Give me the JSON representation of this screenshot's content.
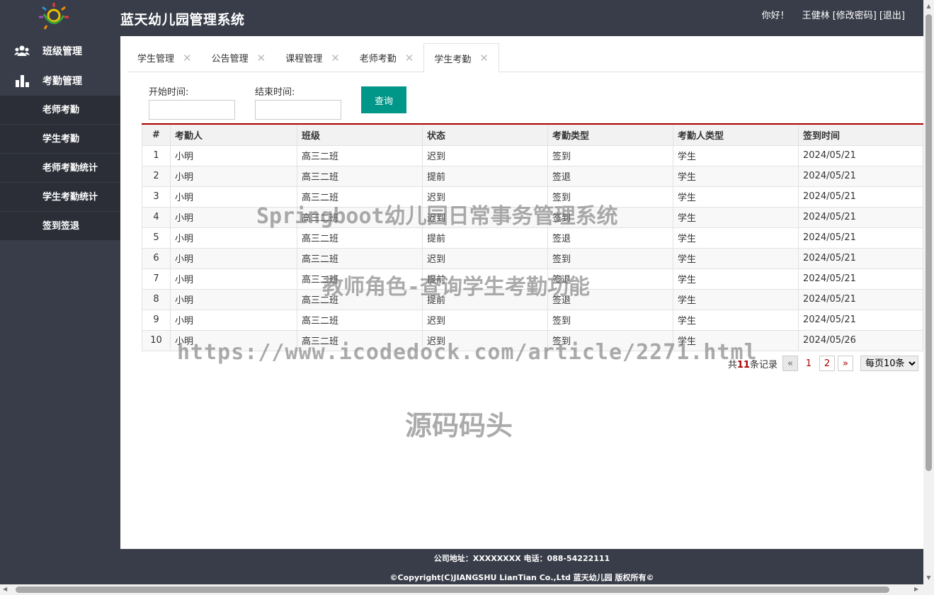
{
  "header": {
    "title": "蓝天幼儿园管理系统",
    "greeting": "你好！",
    "username": "王健林",
    "change_password": "[修改密码]",
    "logout": "[退出]"
  },
  "sidebar": {
    "groups": [
      {
        "label": "班级管理",
        "icon": "users-icon"
      },
      {
        "label": "考勤管理",
        "icon": "bar-chart-icon"
      }
    ],
    "sub_items": [
      "老师考勤",
      "学生考勤",
      "老师考勤统计",
      "学生考勤统计",
      "签到签退"
    ]
  },
  "tabs": [
    {
      "label": "学生管理",
      "active": false
    },
    {
      "label": "公告管理",
      "active": false
    },
    {
      "label": "课程管理",
      "active": false
    },
    {
      "label": "老师考勤",
      "active": false
    },
    {
      "label": "学生考勤",
      "active": true
    }
  ],
  "filters": {
    "start_label": "开始时间:",
    "start_value": "",
    "end_label": "结束时间:",
    "end_value": "",
    "query_button": "查询"
  },
  "table": {
    "columns": [
      "#",
      "考勤人",
      "班级",
      "状态",
      "考勤类型",
      "考勤人类型",
      "签到时间"
    ],
    "rows": [
      [
        "1",
        "小明",
        "高三二班",
        "迟到",
        "签到",
        "学生",
        "2024/05/21"
      ],
      [
        "2",
        "小明",
        "高三二班",
        "提前",
        "签退",
        "学生",
        "2024/05/21"
      ],
      [
        "3",
        "小明",
        "高三二班",
        "迟到",
        "签到",
        "学生",
        "2024/05/21"
      ],
      [
        "4",
        "小明",
        "高三二班",
        "迟到",
        "签到",
        "学生",
        "2024/05/21"
      ],
      [
        "5",
        "小明",
        "高三二班",
        "提前",
        "签退",
        "学生",
        "2024/05/21"
      ],
      [
        "6",
        "小明",
        "高三二班",
        "迟到",
        "签到",
        "学生",
        "2024/05/21"
      ],
      [
        "7",
        "小明",
        "高三二班",
        "提前",
        "签退",
        "学生",
        "2024/05/21"
      ],
      [
        "8",
        "小明",
        "高三二班",
        "提前",
        "签退",
        "学生",
        "2024/05/21"
      ],
      [
        "9",
        "小明",
        "高三二班",
        "迟到",
        "签到",
        "学生",
        "2024/05/21"
      ],
      [
        "10",
        "小明",
        "高三二班",
        "迟到",
        "签到",
        "学生",
        "2024/05/26"
      ]
    ]
  },
  "pager": {
    "prefix": "共",
    "total": "11",
    "suffix": "条记录",
    "prev": "«",
    "pages": [
      "1",
      "2"
    ],
    "next": "»",
    "per_page": "每页10条"
  },
  "watermarks": [
    "Springboot幼儿园日常事务管理系统",
    "教师角色-查询学生考勤功能",
    "https://www.icodedock.com/article/2271.html",
    "源码码头"
  ],
  "footer": {
    "line1": "公司地址：XXXXXXXX 电话：088-54222111",
    "line2": "©Copyright(C)JIANGSHU LianTian Co.,Ltd 蓝天幼儿园 版权所有©"
  },
  "colors": {
    "chrome": "#393d49",
    "submenu": "#2b2e37",
    "accent": "#009688",
    "table_top_border": "#aa0000"
  }
}
